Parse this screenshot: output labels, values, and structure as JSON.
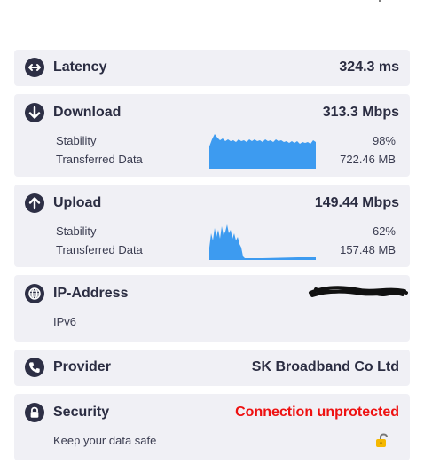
{
  "latency": {
    "label": "Latency",
    "value": "324.3 ms",
    "icon": "arrows-horizontal-icon"
  },
  "download": {
    "label": "Download",
    "value": "313.3 Mbps",
    "icon": "arrow-down-circle-icon",
    "stability_label": "Stability",
    "stability_value": "98%",
    "transferred_label": "Transferred Data",
    "transferred_value": "722.46 MB",
    "graph_color": "#3d9bf0"
  },
  "upload": {
    "label": "Upload",
    "value": "149.44 Mbps",
    "icon": "arrow-up-circle-icon",
    "stability_label": "Stability",
    "stability_value": "62%",
    "transferred_label": "Transferred Data",
    "transferred_value": "157.48 MB",
    "graph_color": "#3d9bf0"
  },
  "ip": {
    "label": "IP-Address",
    "value": "",
    "version": "IPv6",
    "icon": "globe-icon"
  },
  "provider": {
    "label": "Provider",
    "value": "SK Broadband Co Ltd",
    "icon": "phone-icon"
  },
  "security": {
    "label": "Security",
    "value": "Connection unprotected",
    "value_color": "#ee1111",
    "hint": "Keep your data safe",
    "icon": "lock-icon",
    "status_icon": "unlocked-padlock-icon"
  }
}
